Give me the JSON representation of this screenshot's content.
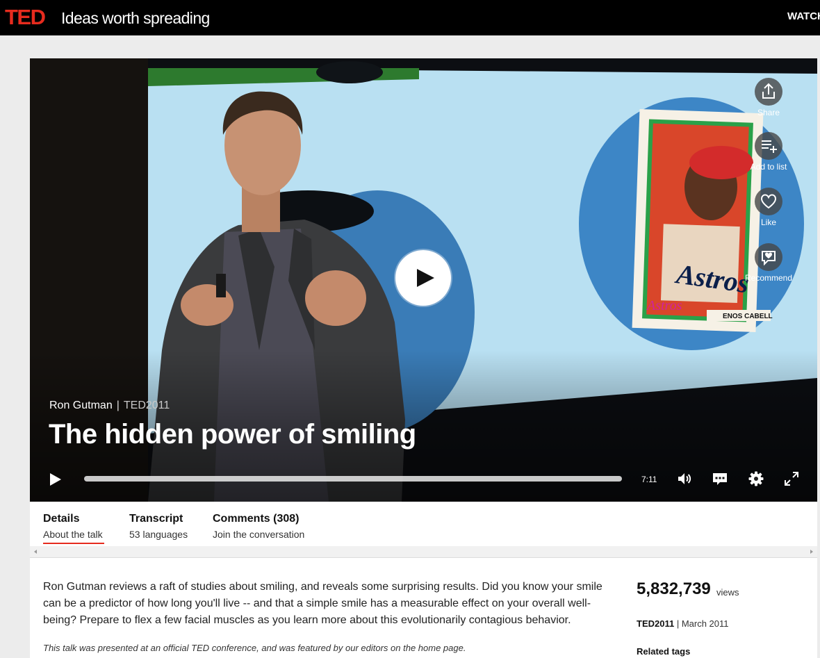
{
  "header": {
    "logo": "TED",
    "tagline": "Ideas worth spreading",
    "nav_partial": "WATCH"
  },
  "video": {
    "speaker": "Ron Gutman",
    "event": "TED2011",
    "title": "The hidden power of smiling",
    "duration": "7:11",
    "actions": {
      "share": "Share",
      "add_to_list": "Add to list",
      "like": "Like",
      "recommend": "Recommend"
    },
    "slide_card": {
      "team": "Astros",
      "player": "ENOS CABELL"
    }
  },
  "tabs": [
    {
      "title": "Details",
      "subtitle": "About the talk"
    },
    {
      "title": "Transcript",
      "subtitle": "53 languages"
    },
    {
      "title": "Comments (308)",
      "subtitle": "Join the conversation"
    }
  ],
  "details": {
    "description": "Ron Gutman reviews a raft of studies about smiling, and reveals some surprising results. Did you know your smile can be a predictor of how long you'll live -- and that a simple smile has a measurable effect on your overall well-being? Prepare to flex a few facial muscles as you learn more about this evolutionarily contagious behavior.",
    "note": "This talk was presented at an official TED conference, and was featured by our editors on the home page.",
    "views": "5,832,739",
    "views_label": "views",
    "event": "TED2011",
    "date": "March 2011",
    "related_tags_heading": "Related tags"
  },
  "colors": {
    "brand_red": "#e62b1e",
    "header_bg": "#000000",
    "page_bg": "#ececec"
  }
}
